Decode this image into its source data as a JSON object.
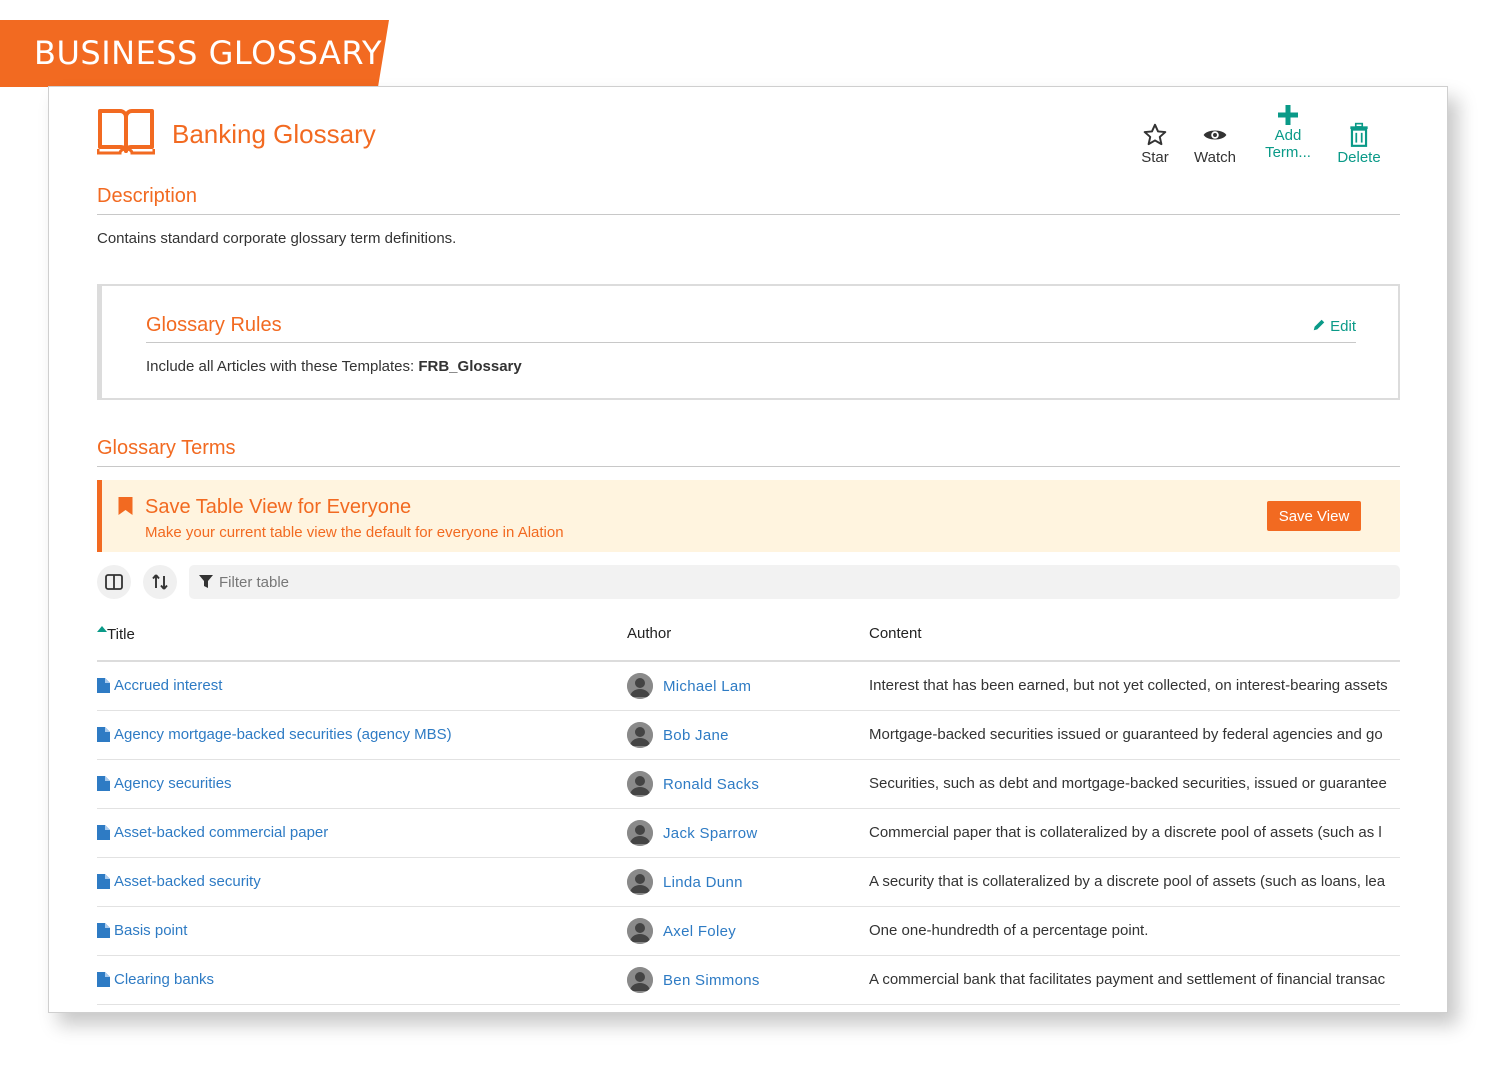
{
  "banner": {
    "label": "BUSINESS GLOSSARY"
  },
  "header": {
    "title": "Banking Glossary",
    "actions": {
      "star": "Star",
      "watch": "Watch",
      "add_line1": "Add",
      "add_line2": "Term...",
      "delete": "Delete"
    }
  },
  "description": {
    "heading": "Description",
    "text": "Contains standard corporate glossary term definitions."
  },
  "rules": {
    "heading": "Glossary Rules",
    "edit": "Edit",
    "text_prefix": "Include all Articles with these Templates: ",
    "template": "FRB_Glossary"
  },
  "terms": {
    "heading": "Glossary Terms",
    "notice": {
      "title": "Save Table View for Everyone",
      "subtitle": "Make your current table view the default for everyone in Alation",
      "button": "Save View"
    },
    "filter_placeholder": "Filter table",
    "columns": {
      "title": "Title",
      "author": "Author",
      "content": "Content"
    },
    "rows": [
      {
        "title": "Accrued interest",
        "author": "Michael Lam",
        "content": "Interest that has been earned, but not yet collected, on interest-bearing assets"
      },
      {
        "title": "Agency mortgage-backed securities (agency MBS)",
        "author": "Bob Jane",
        "content": "Mortgage-backed securities issued or guaranteed by federal agencies and go"
      },
      {
        "title": "Agency securities",
        "author": "Ronald Sacks",
        "content": "Securities, such as debt and mortgage-backed securities, issued or guarantee"
      },
      {
        "title": "Asset-backed commercial paper",
        "author": "Jack Sparrow",
        "content": "Commercial paper that is collateralized by a discrete pool of assets (such as l"
      },
      {
        "title": "Asset-backed security",
        "author": "Linda Dunn",
        "content": "A security that is collateralized by a discrete pool of assets (such as loans, lea"
      },
      {
        "title": "Basis point",
        "author": "Axel Foley",
        "content": "One one-hundredth of a percentage point."
      },
      {
        "title": "Clearing banks",
        "author": "Ben Simmons",
        "content": "A commercial bank that facilitates payment and settlement of financial transac"
      }
    ]
  },
  "colors": {
    "accent": "#f26a21",
    "teal": "#0a9a88",
    "link": "#2e7bc4",
    "notice_bg": "#fff4df"
  }
}
